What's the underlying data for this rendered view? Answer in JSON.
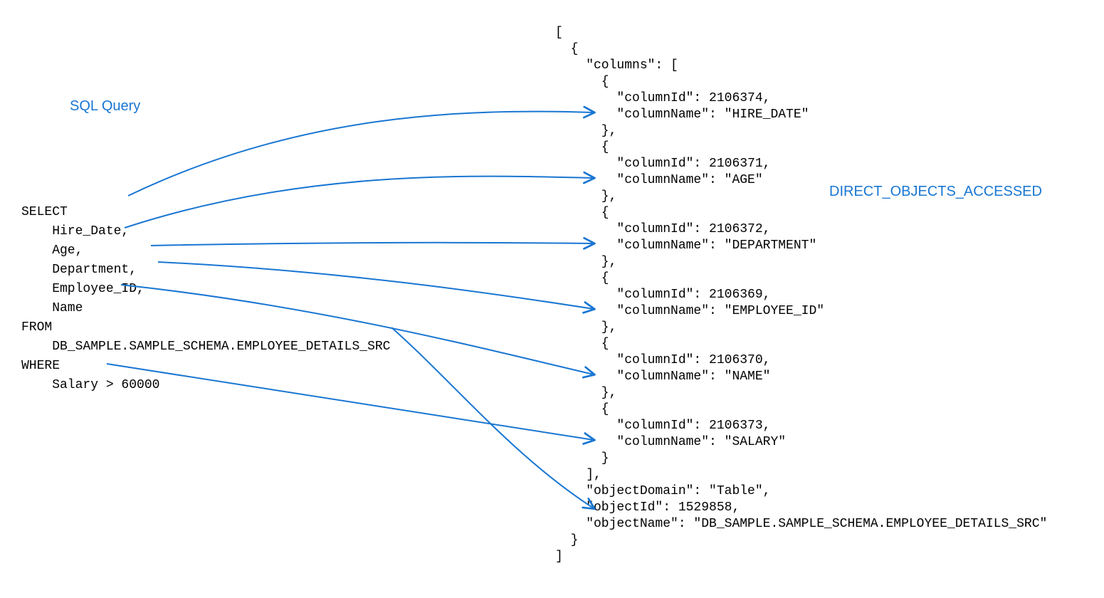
{
  "labels": {
    "sql_query": "SQL Query",
    "direct_objects": "DIRECT_OBJECTS_ACCESSED"
  },
  "sql": {
    "select": "SELECT",
    "col1": "    Hire_Date,",
    "col2": "    Age,",
    "col3": "    Department,",
    "col4": "    Employee_ID,",
    "col5": "    Name",
    "from": "FROM",
    "table": "    DB_SAMPLE.SAMPLE_SCHEMA.EMPLOYEE_DETAILS_SRC",
    "where": "WHERE",
    "cond": "    Salary > 60000"
  },
  "json_text": "[\n  {\n    \"columns\": [\n      {\n        \"columnId\": 2106374,\n        \"columnName\": \"HIRE_DATE\"\n      },\n      {\n        \"columnId\": 2106371,\n        \"columnName\": \"AGE\"\n      },\n      {\n        \"columnId\": 2106372,\n        \"columnName\": \"DEPARTMENT\"\n      },\n      {\n        \"columnId\": 2106369,\n        \"columnName\": \"EMPLOYEE_ID\"\n      },\n      {\n        \"columnId\": 2106370,\n        \"columnName\": \"NAME\"\n      },\n      {\n        \"columnId\": 2106373,\n        \"columnName\": \"SALARY\"\n      }\n    ],\n    \"objectDomain\": \"Table\",\n    \"objectId\": 1529858,\n    \"objectName\": \"DB_SAMPLE.SAMPLE_SCHEMA.EMPLOYEE_DETAILS_SRC\"\n  }\n]",
  "arrow_color": "#1976d2"
}
